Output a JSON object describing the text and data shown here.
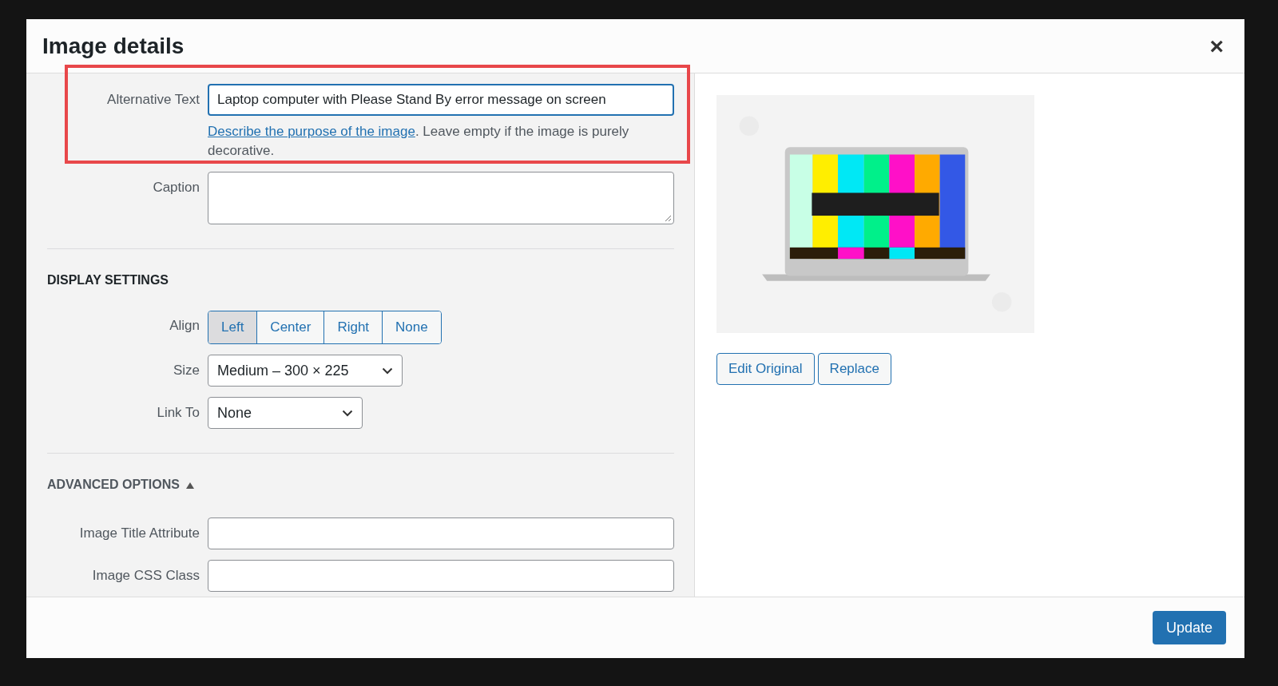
{
  "dialog": {
    "title": "Image details",
    "close": "×"
  },
  "alt_text": {
    "label": "Alternative Text",
    "value": "Laptop computer with Please Stand By error message on screen",
    "help_link": "Describe the purpose of the image",
    "help_text": ". Leave empty if the image is purely decorative.",
    "highlighted": true
  },
  "caption": {
    "label": "Caption"
  },
  "display_settings": {
    "heading": "DISPLAY SETTINGS",
    "align": {
      "label": "Align",
      "options": [
        {
          "label": "Left",
          "selected": true
        },
        {
          "label": "Center",
          "selected": false
        },
        {
          "label": "Right",
          "selected": false
        },
        {
          "label": "None",
          "selected": false
        }
      ]
    },
    "size": {
      "label": "Size",
      "value": "Medium – 300 × 225"
    },
    "link_to": {
      "label": "Link To",
      "value": "None"
    }
  },
  "advanced_options": {
    "heading": "ADVANCED OPTIONS",
    "expanded": true,
    "fields": [
      {
        "label": "Image Title Attribute"
      },
      {
        "label": "Image CSS Class"
      }
    ]
  },
  "preview": {
    "kind": "picture",
    "buttons": [
      "Edit Original",
      "Replace"
    ]
  },
  "footer": {
    "button": "Update"
  }
}
